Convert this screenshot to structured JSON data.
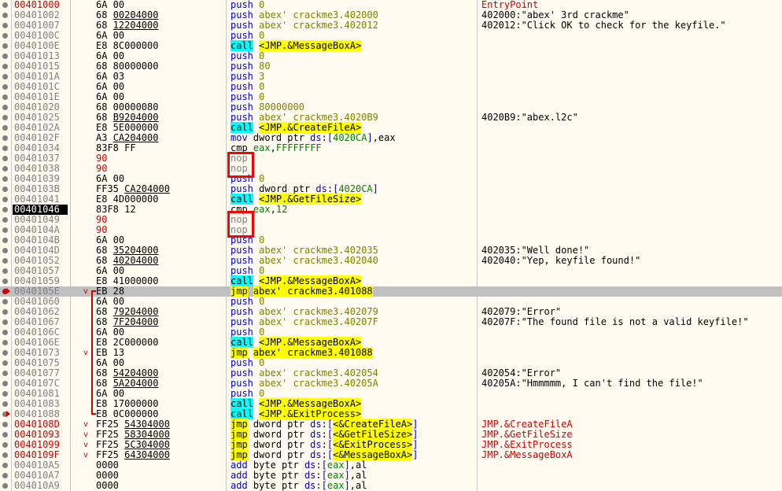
{
  "rows": [
    {
      "addr": "00401000",
      "addr_style": "red",
      "bp": "gray",
      "hex": "6A 00",
      "mn": "push",
      "op": "0",
      "cmt": "EntryPoint",
      "cmt_style": "red"
    },
    {
      "addr": "00401002",
      "bp": "gray",
      "hex": "68 00204000",
      "mn": "push",
      "op": "abex' crackme3.402000",
      "cmt": "402000:\"abex' 3rd crackme\""
    },
    {
      "addr": "00401007",
      "bp": "gray",
      "hex": "68 12204000",
      "mn": "push",
      "op": "abex' crackme3.402012",
      "cmt": "402012:\"Click OK to check for the keyfile.\""
    },
    {
      "addr": "0040100C",
      "bp": "gray",
      "hex": "6A 00",
      "mn": "push",
      "op": "0"
    },
    {
      "addr": "0040100E",
      "bp": "gray",
      "hex": "E8 8C000000",
      "mn": "call",
      "op": "<JMP.&MessageBoxA>"
    },
    {
      "addr": "00401013",
      "bp": "gray",
      "hex": "6A 00",
      "mn": "push",
      "op": "0"
    },
    {
      "addr": "00401015",
      "bp": "gray",
      "hex": "68 80000000",
      "mn": "push",
      "op": "80"
    },
    {
      "addr": "0040101A",
      "bp": "gray",
      "hex": "6A 03",
      "mn": "push",
      "op": "3"
    },
    {
      "addr": "0040101C",
      "bp": "gray",
      "hex": "6A 00",
      "mn": "push",
      "op": "0"
    },
    {
      "addr": "0040101E",
      "bp": "gray",
      "hex": "6A 00",
      "mn": "push",
      "op": "0"
    },
    {
      "addr": "00401020",
      "bp": "gray",
      "hex": "68 00000080",
      "mn": "push",
      "op": "80000000"
    },
    {
      "addr": "00401025",
      "bp": "gray",
      "hex": "68 B9204000",
      "mn": "push",
      "op": "abex' crackme3.4020B9",
      "cmt": "4020B9:\"abex.l2c\""
    },
    {
      "addr": "0040102A",
      "bp": "gray",
      "hex": "E8 5E000000",
      "mn": "call",
      "op": "<JMP.&CreateFileA>"
    },
    {
      "addr": "0040102F",
      "bp": "gray",
      "hex": "A3 CA204000",
      "mn": "mov",
      "op": "dword ptr ds:[4020CA],eax"
    },
    {
      "addr": "00401034",
      "bp": "gray",
      "hex": "83F8 FF",
      "mn": "cmp",
      "op": "eax,FFFFFFFF"
    },
    {
      "addr": "00401037",
      "bp": "gray",
      "hex": "90",
      "hex_style": "red",
      "mn": "nop",
      "op": ""
    },
    {
      "addr": "00401038",
      "bp": "gray",
      "hex": "90",
      "hex_style": "red",
      "mn": "nop",
      "op": ""
    },
    {
      "addr": "00401039",
      "bp": "gray",
      "hex": "6A 00",
      "mn": "push",
      "op": "0"
    },
    {
      "addr": "0040103B",
      "bp": "gray",
      "hex": "FF35 CA204000",
      "mn": "push",
      "op": "dword ptr ds:[4020CA]"
    },
    {
      "addr": "00401041",
      "bp": "gray",
      "hex": "E8 4D000000",
      "mn": "call",
      "op": "<JMP.&GetFileSize>"
    },
    {
      "addr": "00401046",
      "addr_style": "eip",
      "bp": "gray",
      "hex": "83F8 12",
      "mn": "cmp",
      "op": "eax,12"
    },
    {
      "addr": "00401049",
      "bp": "gray",
      "hex": "90",
      "hex_style": "red",
      "mn": "nop",
      "op": ""
    },
    {
      "addr": "0040104A",
      "bp": "gray",
      "hex": "90",
      "hex_style": "red",
      "mn": "nop",
      "op": ""
    },
    {
      "addr": "0040104B",
      "bp": "gray",
      "hex": "6A 00",
      "mn": "push",
      "op": "0"
    },
    {
      "addr": "0040104D",
      "bp": "gray",
      "hex": "68 35204000",
      "mn": "push",
      "op": "abex' crackme3.402035",
      "cmt": "402035:\"Well done!\""
    },
    {
      "addr": "00401052",
      "bp": "gray",
      "hex": "68 40204000",
      "mn": "push",
      "op": "abex' crackme3.402040",
      "cmt": "402040:\"Yep, keyfile found!\""
    },
    {
      "addr": "00401057",
      "bp": "gray",
      "hex": "6A 00",
      "mn": "push",
      "op": "0"
    },
    {
      "addr": "00401059",
      "bp": "gray",
      "hex": "E8 41000000",
      "mn": "call",
      "op": "<JMP.&MessageBoxA>"
    },
    {
      "addr": "0040105E",
      "bp": "red",
      "arrow": true,
      "highlight": true,
      "jv": "v",
      "hex": "EB 28",
      "mn": "jmp",
      "op": "abex' crackme3.401088"
    },
    {
      "addr": "00401060",
      "bp": "gray",
      "hex": "6A 00",
      "mn": "push",
      "op": "0"
    },
    {
      "addr": "00401062",
      "bp": "gray",
      "hex": "68 79204000",
      "mn": "push",
      "op": "abex' crackme3.402079",
      "cmt": "402079:\"Error\""
    },
    {
      "addr": "00401067",
      "bp": "gray",
      "hex": "68 7F204000",
      "mn": "push",
      "op": "abex' crackme3.40207F",
      "cmt": "40207F:\"The found file is not a valid keyfile!\""
    },
    {
      "addr": "0040106C",
      "bp": "gray",
      "hex": "6A 00",
      "mn": "push",
      "op": "0"
    },
    {
      "addr": "0040106E",
      "bp": "gray",
      "hex": "E8 2C000000",
      "mn": "call",
      "op": "<JMP.&MessageBoxA>"
    },
    {
      "addr": "00401073",
      "bp": "gray",
      "jv": "v",
      "hex": "EB 13",
      "mn": "jmp",
      "op": "abex' crackme3.401088"
    },
    {
      "addr": "00401075",
      "bp": "gray",
      "hex": "6A 00",
      "mn": "push",
      "op": "0"
    },
    {
      "addr": "00401077",
      "bp": "gray",
      "hex": "68 54204000",
      "mn": "push",
      "op": "abex' crackme3.402054",
      "cmt": "402054:\"Error\""
    },
    {
      "addr": "0040107C",
      "bp": "gray",
      "hex": "68 5A204000",
      "mn": "push",
      "op": "abex' crackme3.40205A",
      "cmt": "40205A:\"Hmmmmm, I can't find the file!\""
    },
    {
      "addr": "00401081",
      "bp": "gray",
      "hex": "6A 00",
      "mn": "push",
      "op": "0"
    },
    {
      "addr": "00401083",
      "bp": "gray",
      "hex": "E8 17000000",
      "mn": "call",
      "op": "<JMP.&MessageBoxA>"
    },
    {
      "addr": "00401088",
      "bp": "gray",
      "arrow": true,
      "hex": "E8 0C000000",
      "mn": "call",
      "op": "<JMP.&ExitProcess>"
    },
    {
      "addr": "0040108D",
      "addr_style": "red",
      "bp": "gray",
      "jv": "v",
      "hex": "FF25 54304000",
      "mn": "jmp",
      "op": "dword ptr ds:[<&CreateFileA>]",
      "cmt": "JMP.&CreateFileA",
      "cmt_style": "red"
    },
    {
      "addr": "00401093",
      "addr_style": "red",
      "bp": "gray",
      "jv": "v",
      "hex": "FF25 58304000",
      "mn": "jmp",
      "op": "dword ptr ds:[<&GetFileSize>]",
      "cmt": "JMP.&GetFileSize",
      "cmt_style": "red"
    },
    {
      "addr": "00401099",
      "addr_style": "red",
      "bp": "gray",
      "jv": "v",
      "hex": "FF25 5C304000",
      "mn": "jmp",
      "op": "dword ptr ds:[<&ExitProcess>]",
      "cmt": "JMP.&ExitProcess",
      "cmt_style": "red"
    },
    {
      "addr": "0040109F",
      "addr_style": "red",
      "bp": "gray",
      "jv": "v",
      "hex": "FF25 64304000",
      "mn": "jmp",
      "op": "dword ptr ds:[<&MessageBoxA>]",
      "cmt": "JMP.&MessageBoxA",
      "cmt_style": "red"
    },
    {
      "addr": "004010A5",
      "bp": "gray",
      "hex": "0000",
      "mn": "add",
      "op": "byte ptr ds:[eax],al"
    },
    {
      "addr": "004010A7",
      "bp": "gray",
      "hex": "0000",
      "mn": "add",
      "op": "byte ptr ds:[eax],al"
    },
    {
      "addr": "004010A9",
      "bp": "gray",
      "hex": "0000",
      "mn": "add",
      "op": "byte ptr ds:[eax],al"
    }
  ],
  "colors": {
    "background": "#fffbf0",
    "call_highlight": "#00ffff",
    "jmp_highlight": "#ffff00",
    "eip_bg": "#000000",
    "annotation_box": "#ff0000"
  }
}
